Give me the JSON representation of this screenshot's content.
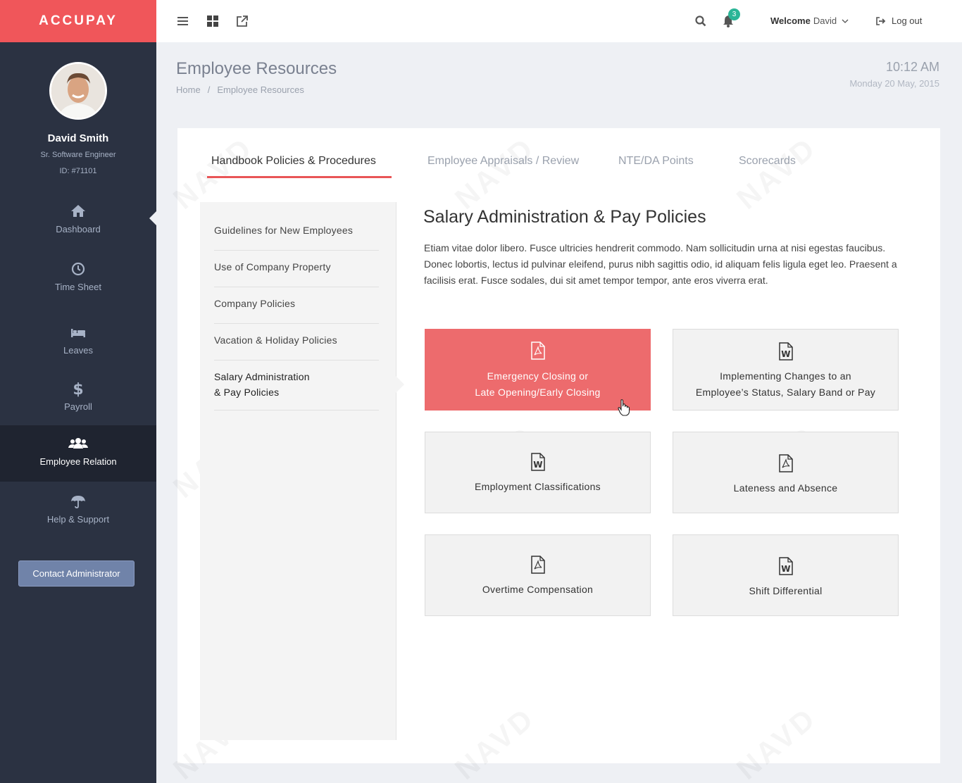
{
  "brand": "ACCUPAY",
  "user": {
    "name": "David Smith",
    "role": "Sr. Software Engineer",
    "id": "ID: #71101"
  },
  "nav": [
    {
      "label": "Dashboard",
      "icon": "home-icon"
    },
    {
      "label": "Time Sheet",
      "icon": "clock-icon"
    },
    {
      "label": "Leaves",
      "icon": "bed-icon"
    },
    {
      "label": "Payroll",
      "icon": "dollar-icon"
    },
    {
      "label": "Employee Relation",
      "icon": "users-icon",
      "active": true
    },
    {
      "label": "Help & Support",
      "icon": "umbrella-icon"
    }
  ],
  "contact_button": "Contact Administrator",
  "topbar": {
    "notification_count": "3",
    "welcome_label": "Welcome",
    "welcome_user": "David",
    "logout_label": "Log out"
  },
  "page": {
    "title": "Employee Resources",
    "breadcrumb": [
      "Home",
      "/",
      "Employee Resources"
    ],
    "time": "10:12 AM",
    "date": "Monday 20 May, 2015"
  },
  "tabs": [
    {
      "label": "Handbook Policies & Procedures",
      "active": true
    },
    {
      "label": "Employee Appraisals / Review"
    },
    {
      "label": "NTE/DA Points"
    },
    {
      "label": "Scorecards"
    }
  ],
  "subnav": [
    {
      "label": "Guidelines for New Employees"
    },
    {
      "label": "Use of Company Property"
    },
    {
      "label": "Company Policies"
    },
    {
      "label": "Vacation & Holiday Policies"
    },
    {
      "label": "Salary Administration & Pay Policies",
      "line1": "Salary Administration",
      "line2": "& Pay Policies",
      "active": true
    }
  ],
  "content": {
    "title": "Salary Administration & Pay Policies",
    "text": "Etiam vitae dolor libero. Fusce ultricies hendrerit commodo. Nam sollicitudin urna at nisi egestas faucibus. Donec lobortis, lectus id pulvinar eleifend, purus nibh sagittis odio, id aliquam felis ligula eget leo. Praesent a facilisis erat. Fusce sodales, dui sit amet tempor tempor, ante eros viverra erat."
  },
  "documents": [
    {
      "line1": "Emergency Closing or",
      "line2": "Late Opening/Early Closing",
      "icon": "pdf-icon",
      "active": true
    },
    {
      "line1": "Implementing Changes to an",
      "line2": "Employee’s Status, Salary Band or Pay",
      "icon": "word-icon"
    },
    {
      "line1": "Employment Classifications",
      "icon": "word-icon"
    },
    {
      "line1": "Lateness and Absence",
      "icon": "pdf-icon"
    },
    {
      "line1": "Overtime Compensation",
      "icon": "pdf-icon"
    },
    {
      "line1": "Shift Differential",
      "icon": "word-icon"
    }
  ],
  "colors": {
    "brand": "#f0565a",
    "sidebar": "#2b3242",
    "accent": "#ed6b6d",
    "badge": "#2bb597"
  }
}
